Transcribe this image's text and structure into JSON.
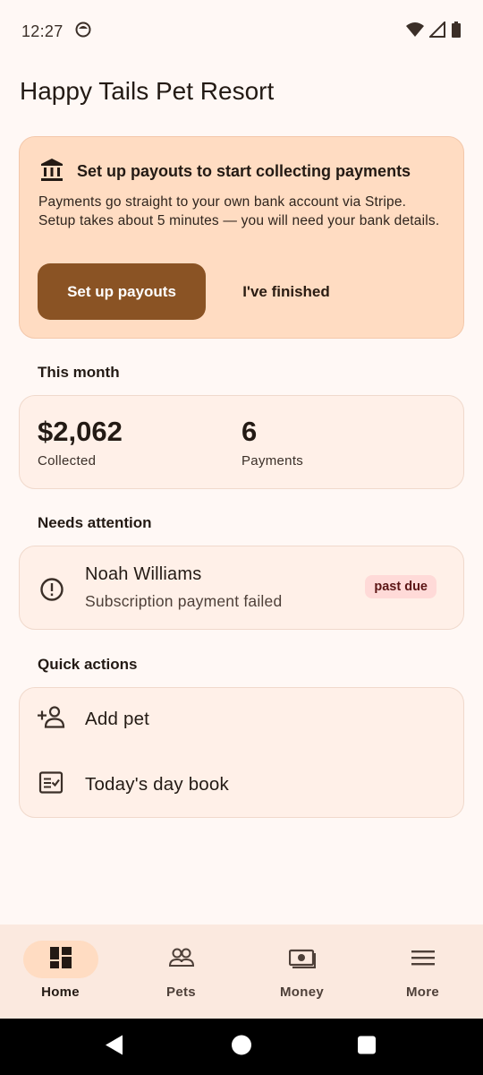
{
  "status_bar": {
    "time": "12:27"
  },
  "page": {
    "title": "Happy Tails Pet Resort"
  },
  "payout_card": {
    "icon": "bank-icon",
    "title": "Set up payouts to start collecting payments",
    "body": "Payments go straight to your own bank account via Stripe. Setup takes about 5 minutes — you will need your bank details.",
    "primary_button": "Set up payouts",
    "secondary_button": "I've finished"
  },
  "this_month": {
    "heading": "This month",
    "collected_value": "$2,062",
    "collected_label": "Collected",
    "payments_value": "6",
    "payments_label": "Payments"
  },
  "needs_attention": {
    "heading": "Needs attention",
    "items": [
      {
        "name": "Noah Williams",
        "detail": "Subscription payment failed",
        "badge": "past due",
        "icon": "alert-circle-icon"
      }
    ]
  },
  "quick_actions": {
    "heading": "Quick actions",
    "items": [
      {
        "label": "Add pet",
        "icon": "person-add-icon"
      },
      {
        "label": "Today's day book",
        "icon": "checklist-icon"
      }
    ]
  },
  "bottom_nav": {
    "items": [
      {
        "label": "Home",
        "icon": "dashboard-icon",
        "active": true
      },
      {
        "label": "Pets",
        "icon": "group-icon",
        "active": false
      },
      {
        "label": "Money",
        "icon": "payments-icon",
        "active": false
      },
      {
        "label": "More",
        "icon": "menu-icon",
        "active": false
      }
    ]
  },
  "colors": {
    "background": "#fff8f5",
    "payout_card_bg": "#ffdcc2",
    "primary_button": "#8a5324",
    "badge_bg": "#ffdad8",
    "nav_bg": "#fbe9df"
  }
}
